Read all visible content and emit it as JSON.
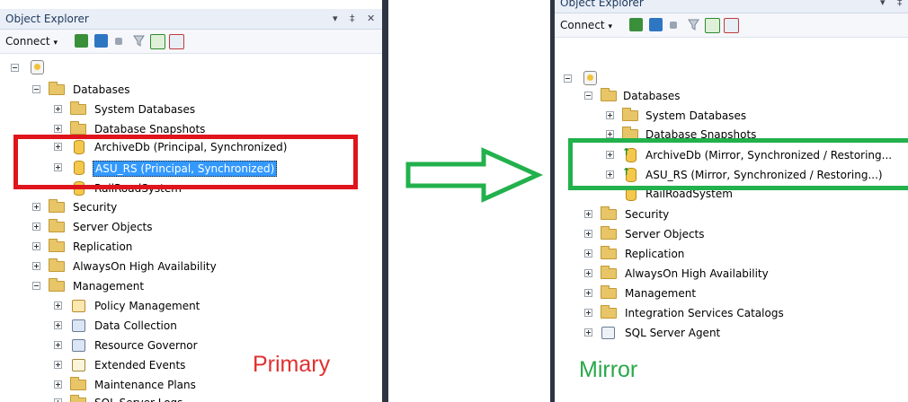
{
  "primary": {
    "panel_title": "Object Explorer",
    "title_controls": "▾ ‡ ✕",
    "connect_label": "Connect",
    "connect_caret": "▾",
    "tree": {
      "databases": "Databases",
      "system_databases": "System Databases",
      "database_snapshots": "Database Snapshots",
      "archive_db": "ArchiveDb (Principal, Synchronized)",
      "asu_rs": "ASU_RS (Principal, Synchronized)",
      "railroad": "RailRoadSystem",
      "security": "Security",
      "server_objects": "Server Objects",
      "replication": "Replication",
      "alwayson": "AlwaysOn High Availability",
      "management": "Management",
      "policy_management": "Policy Management",
      "data_collection": "Data Collection",
      "resource_governor": "Resource Governor",
      "extended_events": "Extended Events",
      "maintenance_plans": "Maintenance Plans",
      "sql_server_logs": "SQL Server Logs"
    },
    "caption": "Primary",
    "caption_color": "#e03030",
    "highlight_color": "#e0141c"
  },
  "mirror": {
    "panel_title": "Object Explorer",
    "title_controls": "▾ ‡",
    "connect_label": "Connect",
    "connect_caret": "▾",
    "tree": {
      "databases": "Databases",
      "system_databases": "System Databases",
      "database_snapshots": "Database Snapshots",
      "archive_db": "ArchiveDb (Mirror, Synchronized / Restoring...",
      "asu_rs": "ASU_RS (Mirror, Synchronized / Restoring...)",
      "railroad": "RailRoadSystem",
      "security": "Security",
      "server_objects": "Server Objects",
      "replication": "Replication",
      "alwayson": "AlwaysOn High Availability",
      "management": "Management",
      "integration_services": "Integration Services Catalogs",
      "sql_server_agent": "SQL Server Agent"
    },
    "caption": "Mirror",
    "caption_color": "#2aa84a",
    "highlight_color": "#22b14c"
  },
  "arrow_color": "#22b14c",
  "icons": {
    "toolbar": [
      "connect-object-explorer-icon",
      "disconnect-icon",
      "stop-icon",
      "filter-icon",
      "refresh-icon",
      "activity-monitor-icon"
    ],
    "db": "database-icon",
    "folder": "folder-icon",
    "server": "server-icon"
  }
}
